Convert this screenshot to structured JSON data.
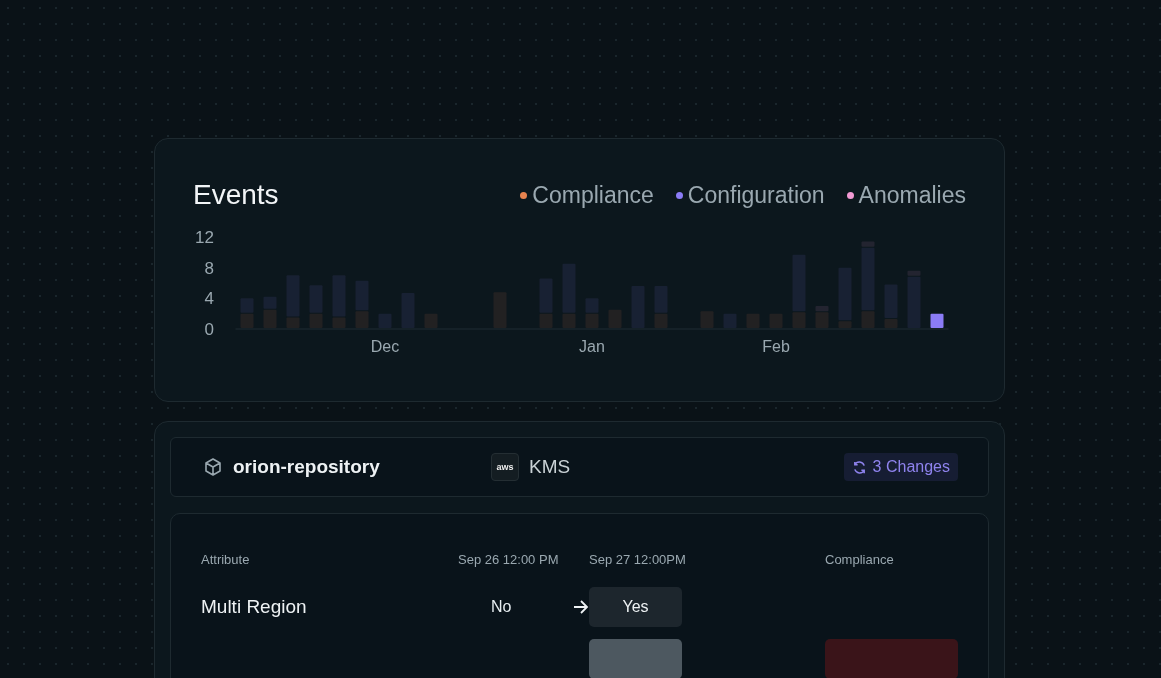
{
  "events_card": {
    "title": "Events",
    "highlight_last_bar": true,
    "chart_data": {
      "type": "bar",
      "stacked": true,
      "categories": [
        null,
        null,
        null,
        null,
        null,
        null,
        "Dec",
        null,
        null,
        null,
        null,
        null,
        null,
        null,
        null,
        "Jan",
        null,
        null,
        null,
        null,
        null,
        null,
        null,
        "Feb",
        null,
        null,
        null,
        null,
        null,
        null,
        null
      ],
      "yticks": [
        {
          "value": 0,
          "label": "0"
        },
        {
          "value": 4,
          "label": "4"
        },
        {
          "value": 8,
          "label": "8"
        },
        {
          "value": 12,
          "label": "12"
        }
      ],
      "ylim": [
        0,
        12
      ],
      "series": [
        {
          "name": "Compliance",
          "color": "#e8834f",
          "values": [
            2,
            2.5,
            1.5,
            2,
            1.5,
            2.3,
            0,
            0,
            2,
            0,
            0,
            4.8,
            0,
            2,
            2,
            2,
            2.5,
            0,
            2,
            0,
            2.3,
            0,
            2,
            2,
            2.2,
            2.2,
            1,
            2.3,
            1.3,
            0,
            0
          ]
        },
        {
          "name": "Configuration",
          "color": "#8b7cf6",
          "values": [
            2,
            1.7,
            5.5,
            3.7,
            5.5,
            4,
            2,
            4.7,
            0,
            0,
            0,
            0,
            0,
            4.6,
            6.5,
            2,
            0,
            5.6,
            3.6,
            0,
            0,
            2,
            0,
            0,
            7.5,
            0,
            7,
            8.3,
            4.5,
            6.8,
            2
          ]
        },
        {
          "name": "Anomalies",
          "color": "#f29ad3",
          "values": [
            0,
            0,
            0,
            0,
            0,
            0,
            0,
            0,
            0,
            0,
            0,
            0,
            0,
            0,
            0,
            0,
            0,
            0,
            0,
            0,
            0,
            0,
            0,
            0,
            0,
            0.8,
            0,
            0.8,
            0,
            0.8,
            0
          ]
        }
      ]
    }
  },
  "resource": {
    "name": "orion-repository",
    "provider_badge": "aws",
    "service": "KMS",
    "changes": "3 Changes"
  },
  "table": {
    "columns": [
      "Attribute",
      "Sep 26 12:00 PM",
      "Sep 27 12:00PM",
      "Compliance"
    ],
    "rows": [
      {
        "kind": "full",
        "attribute": "Multi Region",
        "old": "No",
        "new": "Yes"
      },
      {
        "kind": "partial"
      }
    ]
  }
}
